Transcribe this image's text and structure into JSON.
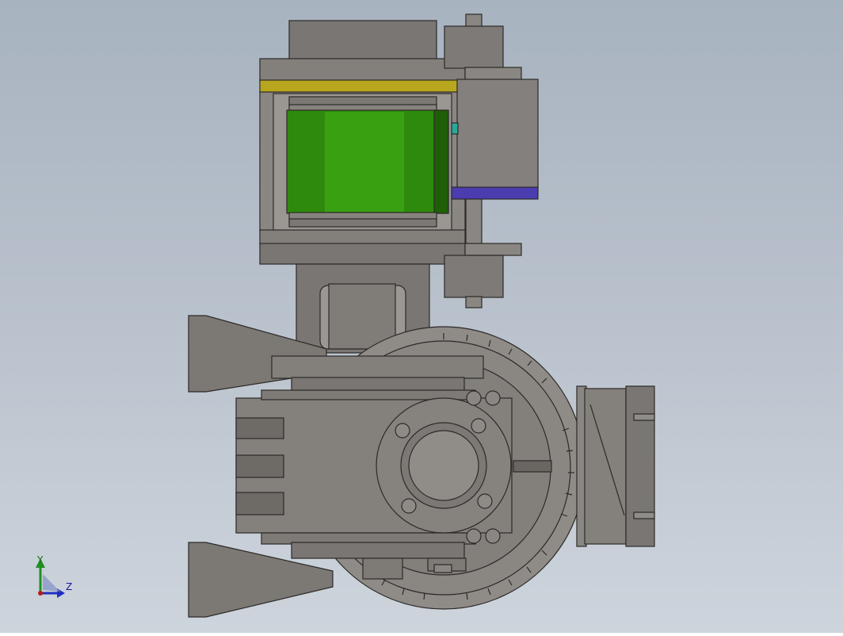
{
  "viewport": {
    "background_top": "#a8b3c0",
    "background_bottom": "#cdd4dc"
  },
  "model": {
    "body_color": "#7f7b77",
    "edge_color": "#2c2a28",
    "motor_coil_color": "#2e8a0c",
    "yellow_plate_color": "#b8a61e",
    "blue_plate_color": "#4b3cb0",
    "teal_tab_color": "#2aa89a"
  },
  "triad": {
    "y_label": "Y",
    "z_label": "Z",
    "y_color": "#1f8f1f",
    "z_color": "#1f2fbf",
    "x_color": "#c01818"
  }
}
